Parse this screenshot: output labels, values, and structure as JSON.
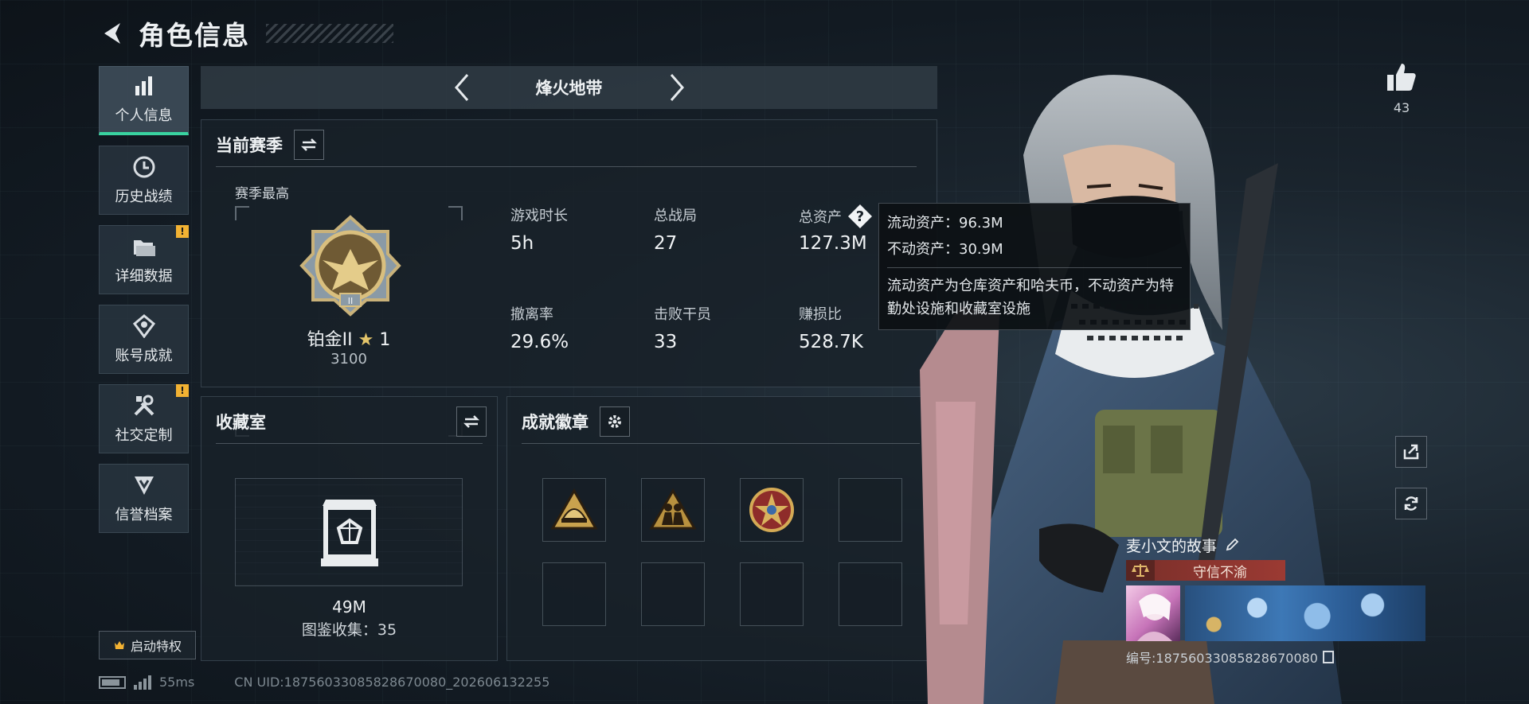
{
  "header": {
    "title": "角色信息"
  },
  "nav": {
    "items": [
      {
        "label": "个人信息",
        "icon": "bar-chart-icon",
        "active": true,
        "badge": ""
      },
      {
        "label": "历史战绩",
        "icon": "clock-icon",
        "active": false,
        "badge": ""
      },
      {
        "label": "详细数据",
        "icon": "folder-icon",
        "active": false,
        "badge": "!"
      },
      {
        "label": "账号成就",
        "icon": "achievement-icon",
        "active": false,
        "badge": ""
      },
      {
        "label": "社交定制",
        "icon": "tools-icon",
        "active": false,
        "badge": "!"
      },
      {
        "label": "信誉档案",
        "icon": "shield-icon",
        "active": false,
        "badge": ""
      }
    ],
    "privilege_label": "启动特权"
  },
  "mode": {
    "title": "烽火地带"
  },
  "season": {
    "title": "当前赛季",
    "best_label": "赛季最高",
    "rank_name": "铂金II",
    "rank_stars": "1",
    "rank_points": "3100",
    "stats": [
      {
        "label": "游戏时长",
        "value": "5h"
      },
      {
        "label": "总战局",
        "value": "27"
      },
      {
        "label": "总资产",
        "value": "127.3M"
      },
      {
        "label": "撤离率",
        "value": "29.6%"
      },
      {
        "label": "击败干员",
        "value": "33"
      },
      {
        "label": "赚损比",
        "value": "528.7K"
      }
    ]
  },
  "tooltip": {
    "liquid": "流动资产：96.3M",
    "fixed": "不动资产：30.9M",
    "description": "流动资产为仓库资产和哈夫币，不动资产为特勤处设施和收藏室设施"
  },
  "collection": {
    "title": "收藏室",
    "value": "49M",
    "count": "图鉴收集：35"
  },
  "badges": {
    "title": "成就徽章"
  },
  "profile": {
    "likes": "43",
    "name": "麦小文的故事",
    "reputation": "守信不渝",
    "id": "编号:187560330858286700​80"
  },
  "footer": {
    "ping": "55ms",
    "uid": "CN UID:187560330858286700​80_202606132255"
  },
  "colors": {
    "accent": "#39d3a0",
    "badge": "#f2b233",
    "reputation": "#9b3a33"
  }
}
